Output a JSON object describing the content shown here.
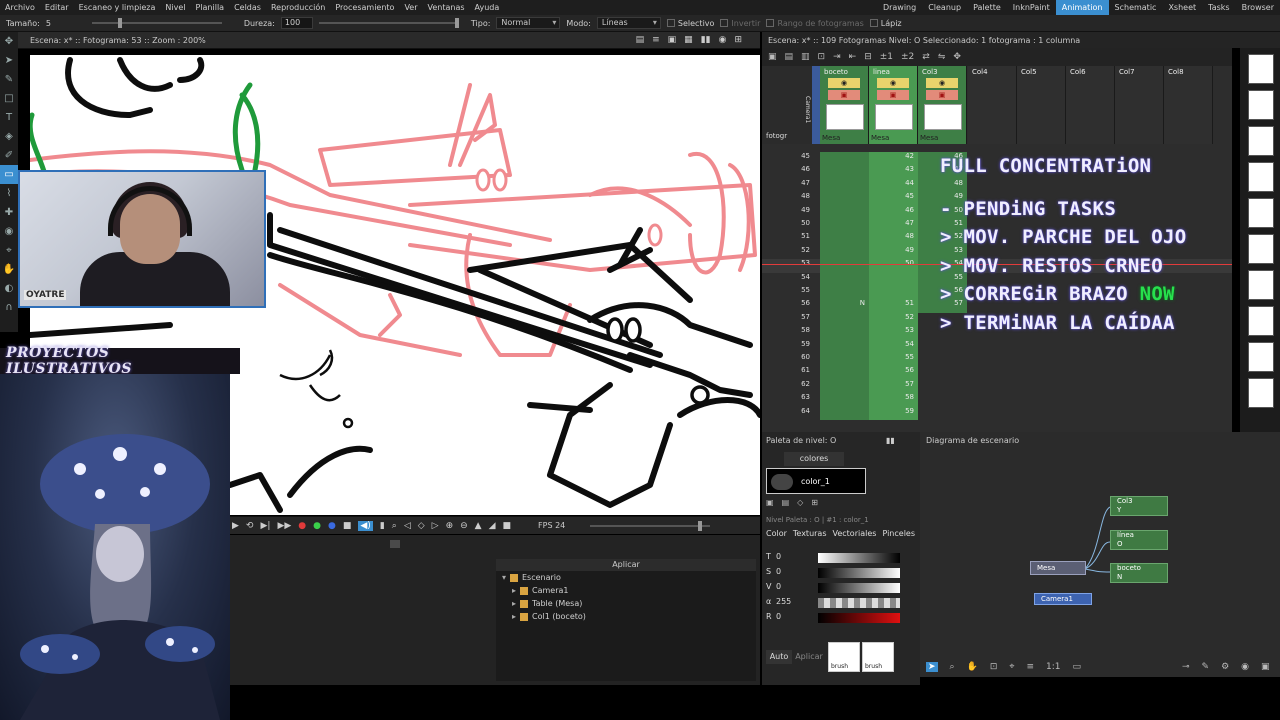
{
  "menu": {
    "items": [
      "Archivo",
      "Editar",
      "Escaneo y limpieza",
      "Nivel",
      "Planilla",
      "Celdas",
      "Reproducción",
      "Procesamiento",
      "Ver",
      "Ventanas",
      "Ayuda"
    ],
    "rooms": [
      "Drawing",
      "Cleanup",
      "Palette",
      "InknPaint",
      "Animation",
      "Schematic",
      "Xsheet",
      "Tasks",
      "Browser"
    ],
    "active_room": "Animation"
  },
  "tool_options": {
    "size_label": "Tamaño:",
    "size_value": "5",
    "hardness_label": "Dureza:",
    "hardness_value": "100",
    "type_label": "Tipo:",
    "type_value": "Normal",
    "mode_label": "Modo:",
    "mode_value": "Líneas",
    "selective_label": "Selectivo",
    "invert_label": "Invertir",
    "range_label": "Rango de fotogramas",
    "pencil_label": "Lápiz"
  },
  "viewer": {
    "header": "Escena: x* :: Fotograma: 53 :: Zoom : 200%"
  },
  "webcam": {
    "shirt_text": "OYATRE"
  },
  "overlay": {
    "project_title": "PROYECTOS ILUSTRATIVOS"
  },
  "playback": {
    "fps_label": "FPS",
    "fps_value": "24"
  },
  "scene_tree": {
    "apply_label": "Aplicar",
    "items": [
      "Escenario",
      "Camera1",
      "Table (Mesa)",
      "Col1 (boceto)"
    ]
  },
  "xsheet": {
    "header": "Escena: x* :: 109 Fotogramas  Nivel: O  Seleccionado: 1 fotograma : 1 columna",
    "frame_label": "fotogr",
    "camera_label": "Camera1",
    "columns": [
      {
        "name": "boceto",
        "level": "Mesa",
        "color": "#3e7f46"
      },
      {
        "name": "linea",
        "level": "Mesa",
        "color": "#4a9a52"
      },
      {
        "name": "Col3",
        "level": "Mesa",
        "color": "#3e7f46"
      },
      {
        "name": "Col4"
      },
      {
        "name": "Col5"
      },
      {
        "name": "Col6"
      },
      {
        "name": "Col7"
      },
      {
        "name": "Col8"
      }
    ],
    "rows": [
      {
        "frame": "45",
        "c1": "42",
        "c3": "46"
      },
      {
        "frame": "46",
        "c1": "43",
        "c3": "47"
      },
      {
        "frame": "47",
        "c1": "44",
        "c3": "48"
      },
      {
        "frame": "48",
        "c1": "45",
        "c3": "49"
      },
      {
        "frame": "49",
        "c1": "46",
        "c3": "50"
      },
      {
        "frame": "50",
        "c1": "47",
        "c3": "51"
      },
      {
        "frame": "51",
        "c1": "48",
        "c3": "52"
      },
      {
        "frame": "52",
        "c1": "49",
        "c3": "53"
      },
      {
        "frame": "53",
        "c1": "50",
        "c3": "54"
      },
      {
        "frame": "54",
        "c1": "",
        "c3": "55"
      },
      {
        "frame": "55",
        "c1": "",
        "c3": "56"
      },
      {
        "frame": "56",
        "c0": "N",
        "c1": "51",
        "c3": "57"
      },
      {
        "frame": "57",
        "c1": "52",
        "c3": ""
      },
      {
        "frame": "58",
        "c1": "53",
        "c3": ""
      },
      {
        "frame": "59",
        "c1": "54",
        "c3": ""
      },
      {
        "frame": "60",
        "c1": "55",
        "c3": ""
      },
      {
        "frame": "61",
        "c1": "56",
        "c3": ""
      },
      {
        "frame": "62",
        "c1": "57",
        "c3": ""
      },
      {
        "frame": "63",
        "c1": "58",
        "c3": ""
      },
      {
        "frame": "64",
        "c1": "59",
        "c3": ""
      }
    ],
    "current_frame": "53"
  },
  "overlay_notes": {
    "title": "FULL CONCENTRATiON",
    "lines": [
      "- PENDiNG TASKS",
      "> MOV. PARCHE DEL OJO",
      "> MOV. RESTOS CRNEO",
      "> CORREGiR BRAZO",
      "> TERMiNAR LA CAÍDAA"
    ],
    "now_label": "NOW"
  },
  "palette": {
    "header": "Paleta de nivel: O",
    "page_tab": "colores",
    "style_name": "color_1",
    "level_info": "Nivel Paleta : O | #1 : color_1",
    "tabs": [
      "Color",
      "Texturas",
      "Vectoriales",
      "Pinceles"
    ],
    "channels": [
      {
        "label": "T",
        "value": "0"
      },
      {
        "label": "S",
        "value": "0"
      },
      {
        "label": "V",
        "value": "0"
      },
      {
        "label": "α",
        "value": "255"
      },
      {
        "label": "R",
        "value": "0"
      }
    ],
    "auto_label": "Auto",
    "apply_label": "Aplicar",
    "brush_label": "brush"
  },
  "schematic": {
    "header": "Diagrama de escenario",
    "nodes": [
      {
        "name": "Col3",
        "sub": "Y"
      },
      {
        "name": "línea",
        "sub": "O"
      },
      {
        "name": "boceto",
        "sub": "N"
      },
      {
        "name": "Mesa"
      },
      {
        "name": "Camera1"
      }
    ]
  }
}
